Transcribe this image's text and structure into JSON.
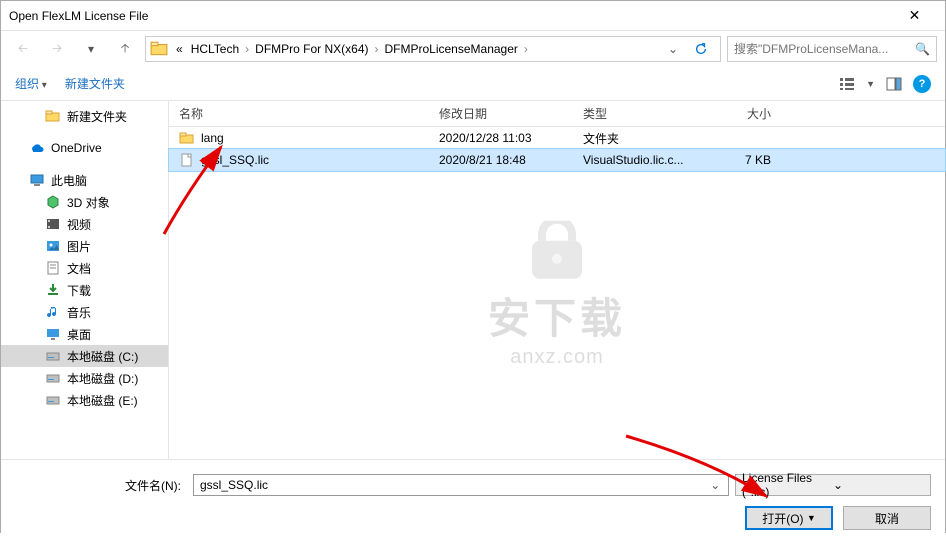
{
  "window_title": "Open FlexLM License File",
  "breadcrumb": {
    "prefix": "«",
    "items": [
      "HCLTech",
      "DFMPro For NX(x64)",
      "DFMProLicenseManager"
    ]
  },
  "search": {
    "placeholder": "搜索\"DFMProLicenseMana..."
  },
  "toolbar": {
    "organize": "组织",
    "new_folder": "新建文件夹"
  },
  "sidebar": {
    "items": [
      {
        "label": "新建文件夹",
        "icon": "folder",
        "sub": true
      },
      {
        "label": "OneDrive",
        "icon": "cloud",
        "sub": false
      },
      {
        "label": "此电脑",
        "icon": "pc",
        "sub": false
      },
      {
        "label": "3D 对象",
        "icon": "3d",
        "sub": true
      },
      {
        "label": "视频",
        "icon": "video",
        "sub": true
      },
      {
        "label": "图片",
        "icon": "image",
        "sub": true
      },
      {
        "label": "文档",
        "icon": "doc",
        "sub": true
      },
      {
        "label": "下载",
        "icon": "download",
        "sub": true
      },
      {
        "label": "音乐",
        "icon": "music",
        "sub": true
      },
      {
        "label": "桌面",
        "icon": "desktop",
        "sub": true
      },
      {
        "label": "本地磁盘 (C:)",
        "icon": "disk",
        "sub": true,
        "selected": true
      },
      {
        "label": "本地磁盘 (D:)",
        "icon": "disk",
        "sub": true
      },
      {
        "label": "本地磁盘 (E:)",
        "icon": "disk",
        "sub": true
      }
    ]
  },
  "columns": {
    "name": "名称",
    "date": "修改日期",
    "type": "类型",
    "size": "大小"
  },
  "rows": [
    {
      "name": "lang",
      "date": "2020/12/28 11:03",
      "type": "文件夹",
      "size": "",
      "icon": "folder"
    },
    {
      "name": "gssl_SSQ.lic",
      "date": "2020/8/21 18:48",
      "type": "VisualStudio.lic.c...",
      "size": "7 KB",
      "icon": "file",
      "selected": true
    }
  ],
  "watermark": {
    "cn": "安下载",
    "en": "anxz.com"
  },
  "bottom": {
    "filename_label": "文件名(N):",
    "filename_value": "gssl_SSQ.lic",
    "filter": "License Files (*.lic)",
    "open": "打开(O)",
    "cancel": "取消"
  }
}
